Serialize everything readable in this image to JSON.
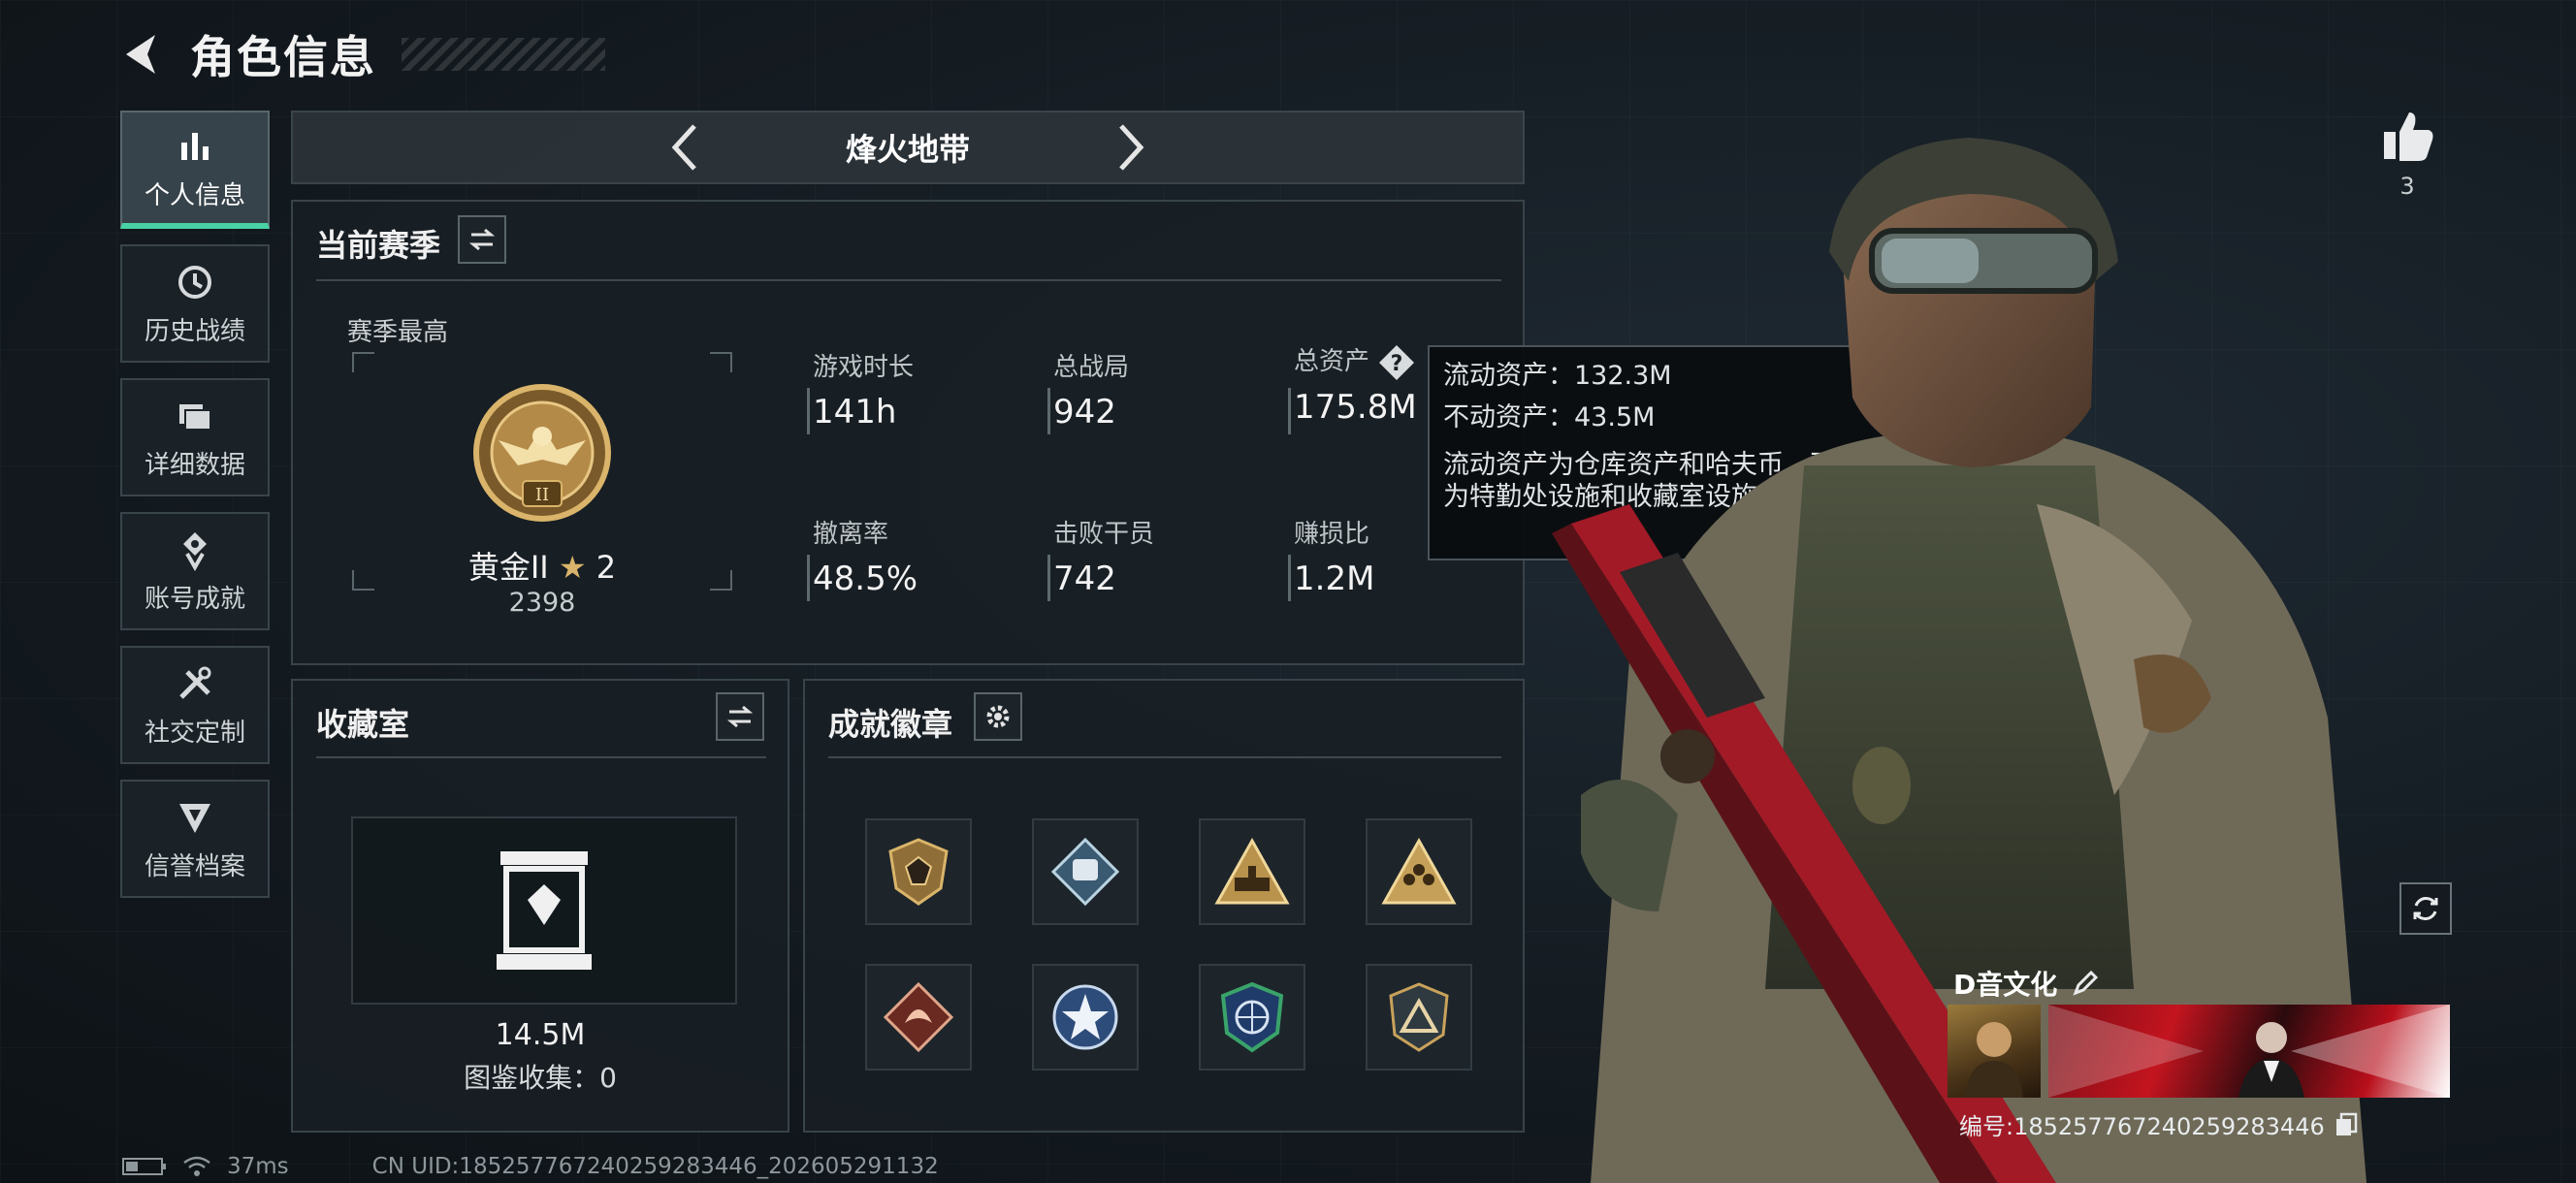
{
  "header": {
    "title": "角色信息"
  },
  "sidebar": {
    "items": [
      {
        "label": "个人信息",
        "icon": "bar-chart-icon",
        "active": true
      },
      {
        "label": "历史战绩",
        "icon": "history-clock-icon",
        "active": false
      },
      {
        "label": "详细数据",
        "icon": "folder-icon",
        "active": false
      },
      {
        "label": "账号成就",
        "icon": "achievement-medal-icon",
        "active": false
      },
      {
        "label": "社交定制",
        "icon": "tools-icon",
        "active": false
      },
      {
        "label": "信誉档案",
        "icon": "credit-shield-icon",
        "active": false
      }
    ]
  },
  "mode_bar": {
    "title": "烽火地带"
  },
  "season": {
    "title": "当前赛季",
    "season_best_label": "赛季最高",
    "rank_name": "黄金II",
    "rank_stars": "2",
    "rank_score": "2398",
    "rank_emblem_numeral": "II",
    "stats": [
      {
        "label": "游戏时长",
        "value": "141h"
      },
      {
        "label": "总战局",
        "value": "942"
      },
      {
        "label": "总资产",
        "value": "175.8M"
      },
      {
        "label": "撤离率",
        "value": "48.5%"
      },
      {
        "label": "击败干员",
        "value": "742"
      },
      {
        "label": "赚损比",
        "value": "1.2M"
      }
    ]
  },
  "tooltip": {
    "liquid": "流动资产：132.3M",
    "fixed": "不动资产：43.5M",
    "desc_line1": "流动资产为仓库资产和哈夫币，不动资产",
    "desc_line2": "为特勤处设施和收藏室设施"
  },
  "collection": {
    "title": "收藏室",
    "value": "14.5M",
    "count_text": "图鉴收集：0"
  },
  "achievements": {
    "title": "成就徽章",
    "badges": [
      "shield-badge-icon",
      "fist-badge-icon",
      "tank-triangle-badge-icon",
      "team-triangle-badge-icon",
      "dragon-badge-icon",
      "star-badge-icon",
      "globe-badge-icon",
      "triangle-shield-badge-icon"
    ]
  },
  "profile": {
    "likes": "3",
    "name": "D音文化",
    "id_text": "编号:1852577672402592834​46"
  },
  "footer": {
    "ping": "37ms",
    "uid": "CN UID:18525776724025928344​6_202605291132"
  },
  "colors": {
    "accent": "#49d3a4",
    "badge_gold": "#b9924c",
    "banner_red": "#c3141f"
  }
}
